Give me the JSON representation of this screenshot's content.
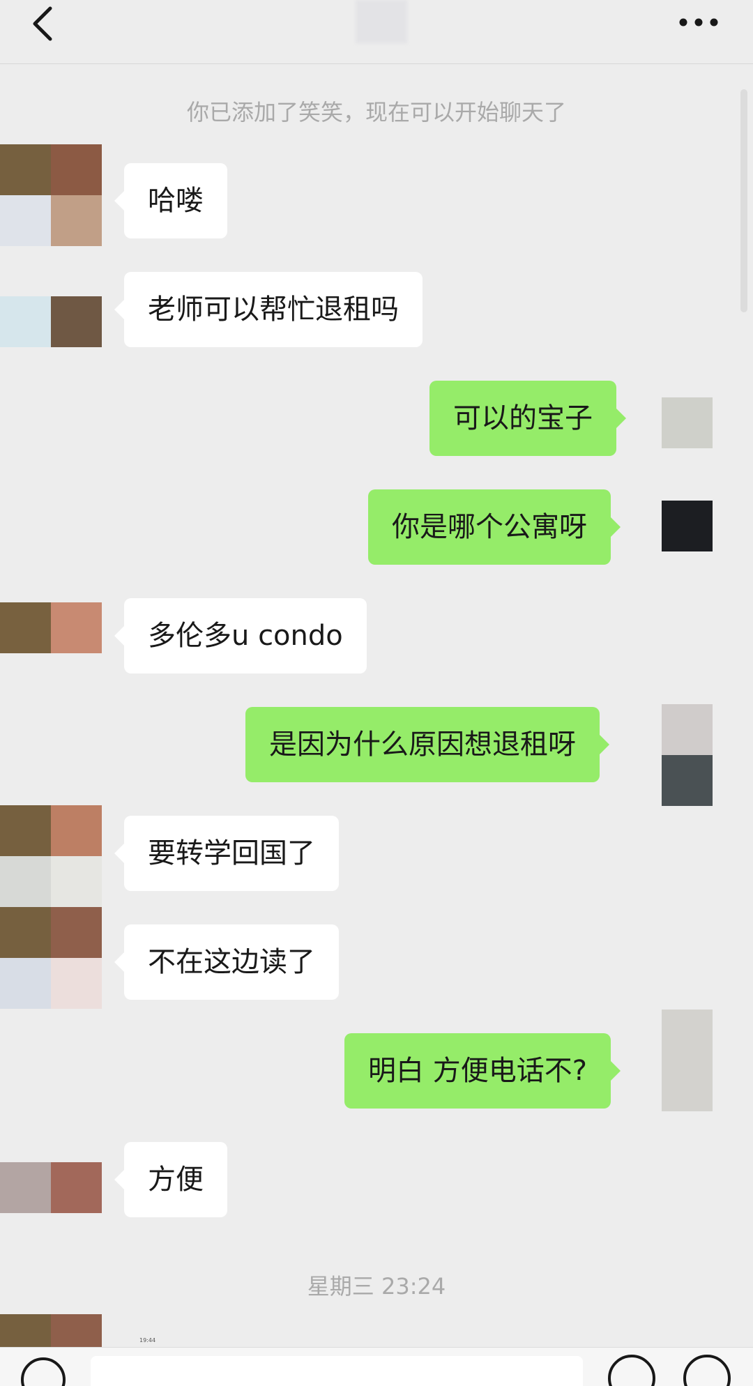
{
  "navbar": {
    "back_icon": "chevron-left-icon",
    "more_icon": "ellipsis-icon"
  },
  "system_messages": {
    "added_notice": "你已添加了笑笑，现在可以开始聊天了",
    "timestamp": "星期三 23:24"
  },
  "messages": [
    {
      "side": "in",
      "text": "哈喽"
    },
    {
      "side": "in",
      "text": "老师可以帮忙退租吗"
    },
    {
      "side": "out",
      "text": "可以的宝子"
    },
    {
      "side": "out",
      "text": "你是哪个公寓呀"
    },
    {
      "side": "in",
      "text": "多伦多u condo"
    },
    {
      "side": "out",
      "text": "是因为什么原因想退租呀"
    },
    {
      "side": "in",
      "text": "要转学回国了"
    },
    {
      "side": "in",
      "text": "不在这边读了"
    },
    {
      "side": "out",
      "text": "明白 方便电话不?"
    },
    {
      "side": "in",
      "text": "方便"
    }
  ],
  "mini_status": "19:44",
  "colors": {
    "background": "#ededed",
    "incoming_bubble": "#ffffff",
    "outgoing_bubble": "#95ec69",
    "system_text": "#a9a9a9"
  }
}
